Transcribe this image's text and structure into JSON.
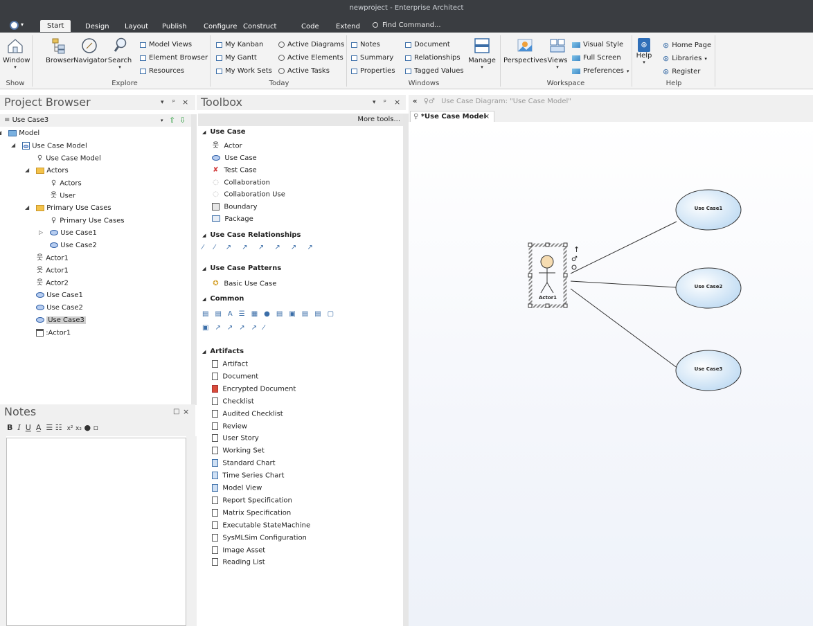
{
  "window_title": "newproject - Enterprise Architect",
  "ribbon_tabs": [
    "Start",
    "Design",
    "Layout",
    "Publish",
    "Configure",
    "Construct",
    "Code",
    "Extend"
  ],
  "find_command": "Find Command...",
  "ribbon": {
    "window_label": "Window",
    "browser_label": "Browser",
    "navigator_label": "Navigator",
    "search_label": "Search",
    "model_views": "Model Views",
    "element_browser": "Element Browser",
    "resources": "Resources",
    "my_kanban": "My Kanban",
    "my_gantt": "My Gantt",
    "my_work_sets": "My Work Sets",
    "active_diagrams": "Active Diagrams",
    "active_elements": "Active Elements",
    "active_tasks": "Active Tasks",
    "notes": "Notes",
    "summary": "Summary",
    "properties": "Properties",
    "document": "Document",
    "relationships": "Relationships",
    "tagged_values": "Tagged Values",
    "manage": "Manage",
    "perspectives": "Perspectives",
    "views": "Views",
    "visual_style": "Visual Style",
    "full_screen": "Full Screen",
    "preferences": "Preferences",
    "help": "Help",
    "home_page": "Home Page",
    "libraries": "Libraries",
    "register": "Register",
    "groups": {
      "show": "Show",
      "explore": "Explore",
      "today": "Today",
      "windows": "Windows",
      "workspace": "Workspace",
      "help": "Help"
    }
  },
  "project_browser": {
    "title": "Project Browser",
    "selector": "Use Case3",
    "items": [
      {
        "label": "Model",
        "icon": "model-folder-icon"
      },
      {
        "label": "Use Case Model",
        "icon": "package-icon"
      },
      {
        "label": "Use Case Model",
        "icon": "use-case-diagram-icon"
      },
      {
        "label": "Actors",
        "icon": "folder-icon"
      },
      {
        "label": "Actors",
        "icon": "use-case-diagram-icon"
      },
      {
        "label": "User",
        "icon": "actor-icon"
      },
      {
        "label": "Primary Use Cases",
        "icon": "folder-icon"
      },
      {
        "label": "Primary Use Cases",
        "icon": "use-case-diagram-icon"
      },
      {
        "label": "Use Case1",
        "icon": "use-case-icon"
      },
      {
        "label": "Use Case2",
        "icon": "use-case-icon"
      },
      {
        "label": "Actor1",
        "icon": "actor-icon"
      },
      {
        "label": "Actor1",
        "icon": "actor-icon"
      },
      {
        "label": "Actor2",
        "icon": "actor-icon"
      },
      {
        "label": "Use Case1",
        "icon": "use-case-icon"
      },
      {
        "label": "Use Case2",
        "icon": "use-case-icon"
      },
      {
        "label": "Use Case3",
        "icon": "use-case-icon"
      },
      {
        "label": ":Actor1",
        "icon": "instance-icon"
      }
    ]
  },
  "notes": {
    "title": "Notes"
  },
  "toolbox": {
    "title": "Toolbox",
    "more_tools": "More tools...",
    "sections": {
      "use_case": "Use Case",
      "use_case_relationships": "Use Case Relationships",
      "use_case_patterns": "Use Case Patterns",
      "common": "Common",
      "artifacts": "Artifacts"
    },
    "use_case_items": [
      "Actor",
      "Use Case",
      "Test Case",
      "Collaboration",
      "Collaboration Use",
      "Boundary",
      "Package"
    ],
    "pattern_items": [
      "Basic Use Case"
    ],
    "artifact_items": [
      "Artifact",
      "Document",
      "Encrypted Document",
      "Checklist",
      "Audited Checklist",
      "Review",
      "User Story",
      "Working Set",
      "Standard Chart",
      "Time Series Chart",
      "Model View",
      "Report Specification",
      "Matrix Specification",
      "Executable StateMachine",
      "SysMLSim Configuration",
      "Image Asset",
      "Reading List"
    ]
  },
  "diagram": {
    "breadcrumb": "Use Case Diagram: \"Use Case Model\"",
    "tab_label": "*Use Case Model",
    "actor_label": "Actor1",
    "use_cases": [
      "Use Case1",
      "Use Case2",
      "Use Case3"
    ]
  }
}
